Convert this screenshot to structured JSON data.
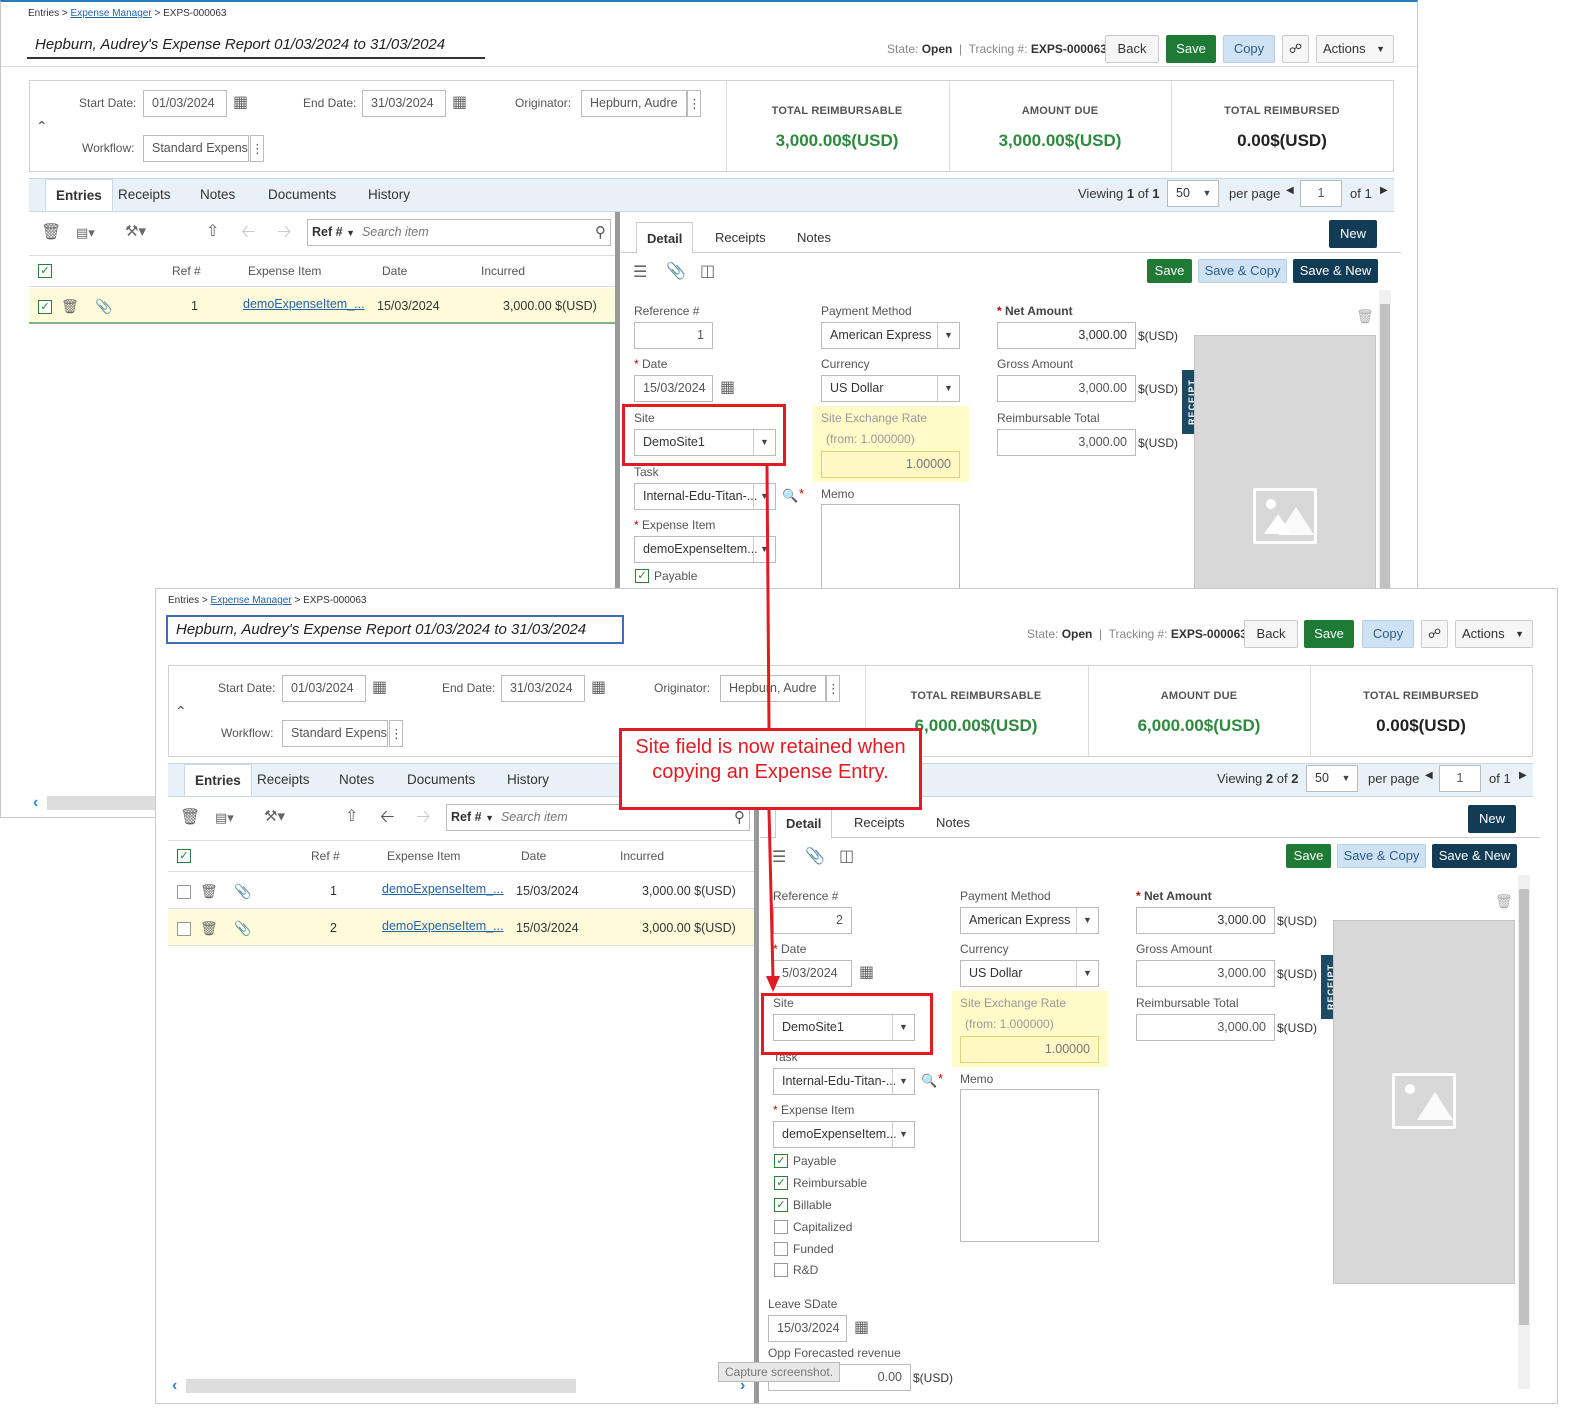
{
  "breadcrumb": {
    "root": "Entries",
    "sep1": ">",
    "link": "Expense Manager",
    "sep2": ">",
    "current": "EXPS-000063"
  },
  "report_title": "Hepburn, Audrey's Expense Report 01/03/2024 to 31/03/2024",
  "state": {
    "label": "State:",
    "value": "Open",
    "tracking_label": "Tracking #:",
    "tracking_value": "EXPS-000063"
  },
  "toolbar": {
    "back": "Back",
    "save": "Save",
    "copy": "Copy",
    "actions": "Actions"
  },
  "header_fields": {
    "start_date_label": "Start Date:",
    "start_date": "01/03/2024",
    "end_date_label": "End Date:",
    "end_date": "31/03/2024",
    "originator_label": "Originator:",
    "originator": "Hepburn, Audre",
    "workflow_label": "Workflow:",
    "workflow": "Standard Expens"
  },
  "summary_labels": {
    "reimbursable": "TOTAL REIMBURSABLE",
    "due": "AMOUNT DUE",
    "reimbursed": "TOTAL REIMBURSED"
  },
  "summary_before": {
    "reimbursable": "3,000.00$(USD)",
    "due": "3,000.00$(USD)",
    "reimbursed": "0.00$(USD)"
  },
  "summary_after": {
    "reimbursable": "6,000.00$(USD)",
    "due": "6,000.00$(USD)",
    "reimbursed": "0.00$(USD)"
  },
  "tabs": [
    "Entries",
    "Receipts",
    "Notes",
    "Documents",
    "History"
  ],
  "pager": {
    "viewing": "Viewing",
    "of": "of",
    "before_pos": "1",
    "before_total": "1",
    "after_pos": "2",
    "after_total": "2",
    "page_size": "50",
    "per_page": "per page",
    "page": "1",
    "page_of": "of 1"
  },
  "search": {
    "ref_label": "Ref #",
    "placeholder": "Search item"
  },
  "grid_headers": {
    "ref": "Ref #",
    "item": "Expense Item",
    "date": "Date",
    "incurred": "Incurred"
  },
  "rows_before": [
    {
      "ref": "1",
      "item": "demoExpenseItem_...",
      "date": "15/03/2024",
      "incurred": "3,000.00 $(USD)"
    }
  ],
  "rows_after": [
    {
      "ref": "1",
      "item": "demoExpenseItem_...",
      "date": "15/03/2024",
      "incurred": "3,000.00 $(USD)"
    },
    {
      "ref": "2",
      "item": "demoExpenseItem_...",
      "date": "15/03/2024",
      "incurred": "3,000.00 $(USD)"
    }
  ],
  "detail": {
    "tabs": [
      "Detail",
      "Receipts",
      "Notes"
    ],
    "new": "New",
    "save": "Save",
    "save_copy": "Save & Copy",
    "save_new": "Save & New",
    "reference_label": "Reference #",
    "reference_before": "1",
    "reference_after": "2",
    "date_label": "Date",
    "date": "15/03/2024",
    "date_after_partial": "5/03/2024",
    "site_label": "Site",
    "site": "DemoSite1",
    "task_label": "Task",
    "task": "Internal-Edu-Titan-...",
    "expense_item_label": "Expense Item",
    "expense_item": "demoExpenseItem...",
    "payment_method_label": "Payment Method",
    "payment_method": "American Express",
    "currency_label": "Currency",
    "currency": "US Dollar",
    "site_rate_label": "Site Exchange Rate",
    "site_rate_from": "(from: 1.000000)",
    "site_rate": "1.00000",
    "memo_label": "Memo",
    "net_label": "Net Amount",
    "net": "3,000.00",
    "gross_label": "Gross Amount",
    "gross": "3,000.00",
    "reimb_label": "Reimbursable Total",
    "reimb": "3,000.00",
    "unit": "$(USD)",
    "receipt_tab": "RECEIPT",
    "checks": [
      {
        "label": "Payable",
        "on": true
      },
      {
        "label": "Reimbursable",
        "on": true
      },
      {
        "label": "Billable",
        "on": true
      },
      {
        "label": "Capitalized",
        "on": false
      },
      {
        "label": "Funded",
        "on": false
      },
      {
        "label": "R&D",
        "on": false
      }
    ],
    "leave_label": "Leave SDate",
    "leave": "15/03/2024",
    "opp_label": "Opp Forecasted revenue",
    "opp": "0.00"
  },
  "annotation": "Site field is now retained when copying an Expense Entry.",
  "tooltip": "Capture screenshot.",
  "colors": {
    "accent_green": "#1f7a36",
    "callout_red": "#e01b24",
    "navy": "#123c55",
    "highlight_yellow": "#fff7c4"
  }
}
